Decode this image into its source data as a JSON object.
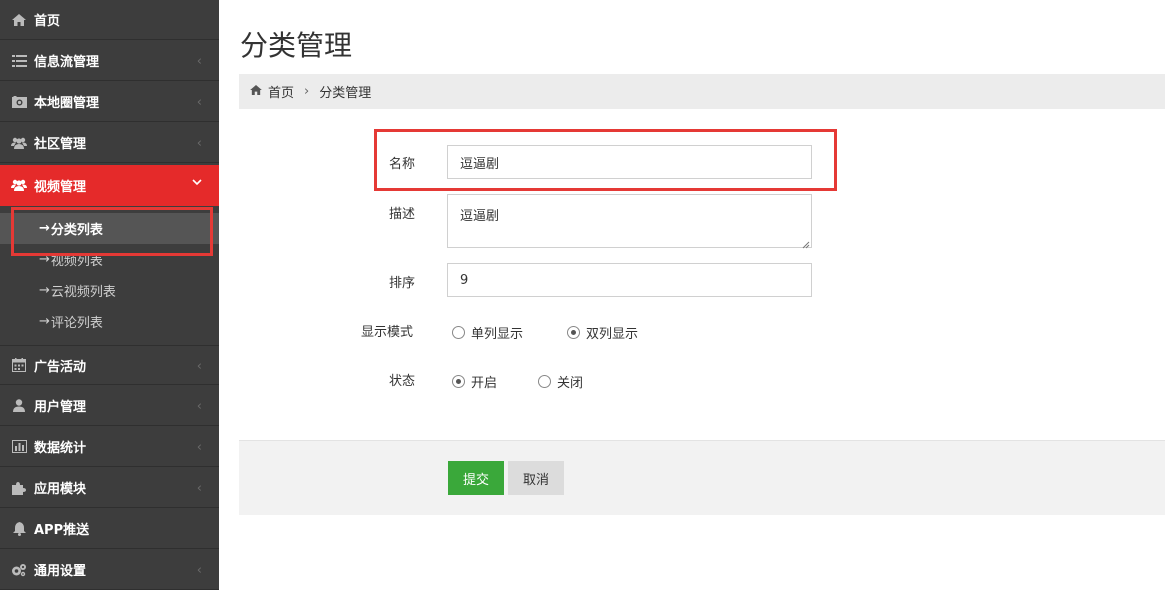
{
  "sidebar": {
    "items": [
      {
        "label": "首页",
        "icon": "home-icon"
      },
      {
        "label": "信息流管理",
        "icon": "list-icon"
      },
      {
        "label": "本地圈管理",
        "icon": "camera-icon"
      },
      {
        "label": "社区管理",
        "icon": "users-icon"
      },
      {
        "label": "视频管理",
        "icon": "users-icon"
      },
      {
        "label": "广告活动",
        "icon": "calendar-icon"
      },
      {
        "label": "用户管理",
        "icon": "user-icon"
      },
      {
        "label": "数据统计",
        "icon": "bar-chart-icon"
      },
      {
        "label": "应用模块",
        "icon": "puzzle-icon"
      },
      {
        "label": "APP推送",
        "icon": "bell-icon"
      },
      {
        "label": "通用设置",
        "icon": "gears-icon"
      }
    ],
    "subitems": [
      {
        "label": "分类列表"
      },
      {
        "label": "视频列表"
      },
      {
        "label": "云视频列表"
      },
      {
        "label": "评论列表"
      }
    ],
    "arrow": "→",
    "chevron": "‹",
    "chevron_open": "⌄"
  },
  "page": {
    "title": "分类管理"
  },
  "breadcrumb": {
    "home": "首页",
    "separator": "›",
    "current": "分类管理"
  },
  "form": {
    "name_label": "名称",
    "name_value": "逗逼剧",
    "desc_label": "描述",
    "desc_value": "逗逼剧",
    "order_label": "排序",
    "order_value": "9",
    "display_label": "显示模式",
    "display_options": [
      "单列显示",
      "双列显示"
    ],
    "display_selected": "双列显示",
    "status_label": "状态",
    "status_options": [
      "开启",
      "关闭"
    ],
    "status_selected": "开启"
  },
  "buttons": {
    "submit": "提交",
    "cancel": "取消"
  },
  "colors": {
    "sidebar_bg": "#3d3d3d",
    "active_red": "#e52a2a",
    "submit_green": "#3aa83a",
    "highlight_red": "#e53935"
  }
}
